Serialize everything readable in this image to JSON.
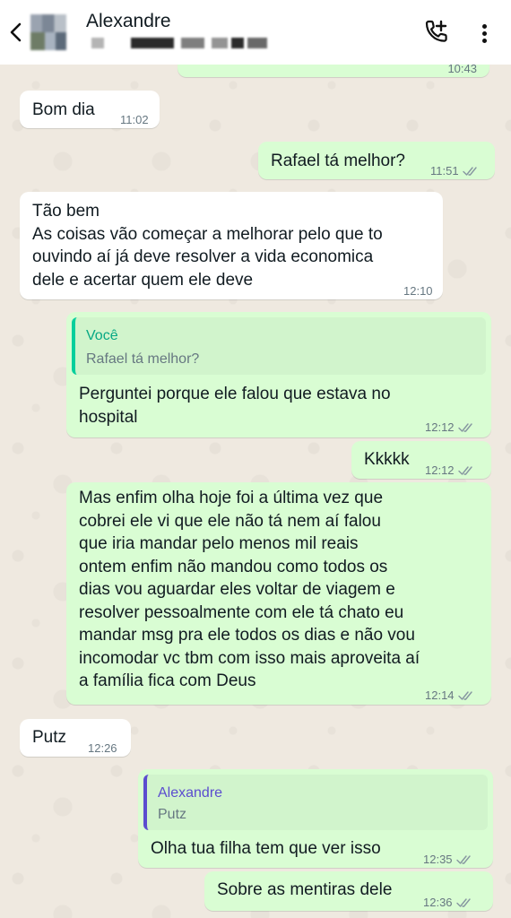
{
  "contact": {
    "name": "Alexandre"
  },
  "messages": [
    {
      "text": "Bom dia",
      "time": "11:02"
    },
    {
      "text": "Rafael tá melhor?",
      "time": "11:51"
    },
    {
      "text": "Tão bem\nAs coisas vão começar a melhorar pelo que to\nouvindo aí já deve resolver a vida economica\ndele e acertar quem ele deve",
      "time": "12:10"
    },
    {
      "quote_author": "Você",
      "quote_text": "Rafael tá melhor?",
      "text": "Perguntei porque ele falou que estava no\nhospital",
      "time": "12:12"
    },
    {
      "text": "Kkkkk",
      "time": "12:12"
    },
    {
      "text": "Mas enfim olha hoje foi a última vez que\ncobrei ele vi que ele não tá nem aí falou\nque iria mandar pelo menos mil reais\nontem enfim não mandou como todos os\ndias vou aguardar eles voltar de viagem e\nresolver pessoalmente com ele tá chato eu\nmandar msg pra ele todos os dias e não vou\nincomodar vc tbm com isso mais aproveita aí\na família fica com Deus",
      "time": "12:14"
    },
    {
      "text": "Putz",
      "time": "12:26"
    },
    {
      "quote_author": "Alexandre",
      "quote_text": "Putz",
      "text": "Olha tua filha tem que ver isso",
      "time": "12:35"
    },
    {
      "text": "Sobre as mentiras dele",
      "time": "12:36"
    }
  ],
  "top_partial_message": {
    "time": "10:43"
  },
  "colors": {
    "outgoing_bubble": "#d9fdd3",
    "incoming_bubble": "#ffffff",
    "read_ticks": "#8696a0",
    "quote_self_bar": "#06cf9c",
    "quote_contact_bar": "#5b4ccf"
  },
  "icons": {
    "back": "arrow-left-icon",
    "call": "add-call-icon",
    "menu": "more-vert-icon"
  }
}
